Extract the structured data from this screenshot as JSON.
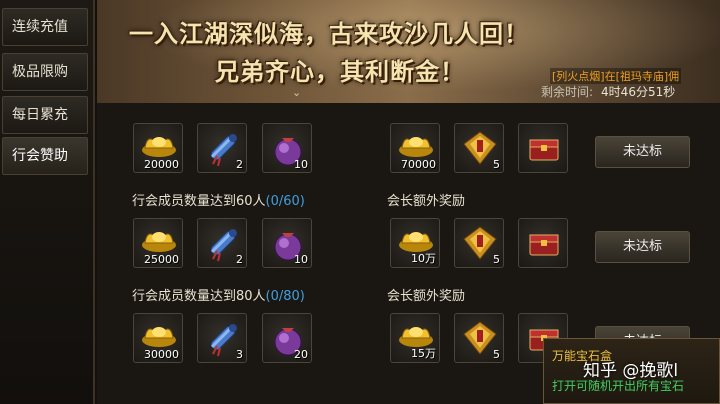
{
  "sidebar": {
    "tabs": [
      {
        "label": "连续充值"
      },
      {
        "label": "极品限购"
      },
      {
        "label": "每日累充"
      },
      {
        "label": "行会赞助"
      }
    ]
  },
  "banner": {
    "line1": "一入江湖深似海，古来攻沙几人回！",
    "line2": "兄弟齐心，其利断金！",
    "notice": "[列火点烟]在[祖玛寺庙]佣",
    "timer_label": "剩余时间:",
    "timer_value": "4时46分51秒"
  },
  "rows": [
    {
      "title": "",
      "progress": "",
      "items": [
        {
          "icon": "gold-ingot",
          "qty": "20000"
        },
        {
          "icon": "scroll",
          "qty": "2"
        },
        {
          "icon": "purple-pouch",
          "qty": "10"
        }
      ],
      "bonus_title": "",
      "bonus_items": [
        {
          "icon": "gold-ingot",
          "qty": "70000"
        },
        {
          "icon": "gold-medal",
          "qty": "5"
        },
        {
          "icon": "red-chest",
          "qty": ""
        }
      ],
      "button": "未达标"
    },
    {
      "title": "行会成员数量达到60人",
      "progress": "(0/60)",
      "items": [
        {
          "icon": "gold-ingot",
          "qty": "25000"
        },
        {
          "icon": "scroll",
          "qty": "2"
        },
        {
          "icon": "purple-pouch",
          "qty": "10"
        }
      ],
      "bonus_title": "会长额外奖励",
      "bonus_items": [
        {
          "icon": "gold-ingot",
          "qty": "10万"
        },
        {
          "icon": "gold-medal",
          "qty": "5"
        },
        {
          "icon": "red-chest",
          "qty": ""
        }
      ],
      "button": "未达标"
    },
    {
      "title": "行会成员数量达到80人",
      "progress": "(0/80)",
      "items": [
        {
          "icon": "gold-ingot",
          "qty": "30000"
        },
        {
          "icon": "scroll",
          "qty": "3"
        },
        {
          "icon": "purple-pouch",
          "qty": "20"
        }
      ],
      "bonus_title": "会长额外奖励",
      "bonus_items": [
        {
          "icon": "gold-ingot",
          "qty": "15万"
        },
        {
          "icon": "gold-medal",
          "qty": "5"
        },
        {
          "icon": "red-chest",
          "qty": ""
        }
      ],
      "button": "未达标"
    }
  ],
  "gem_box": {
    "title": "万能宝石盒",
    "subtitle": "打开可随机开出所有宝石"
  },
  "watermark": "知乎 @挽歌l",
  "colors": {
    "progress": "#3fa0e0",
    "notice": "#f0a020",
    "gem_title": "#f0c040",
    "gem_sub": "#3fd060"
  }
}
